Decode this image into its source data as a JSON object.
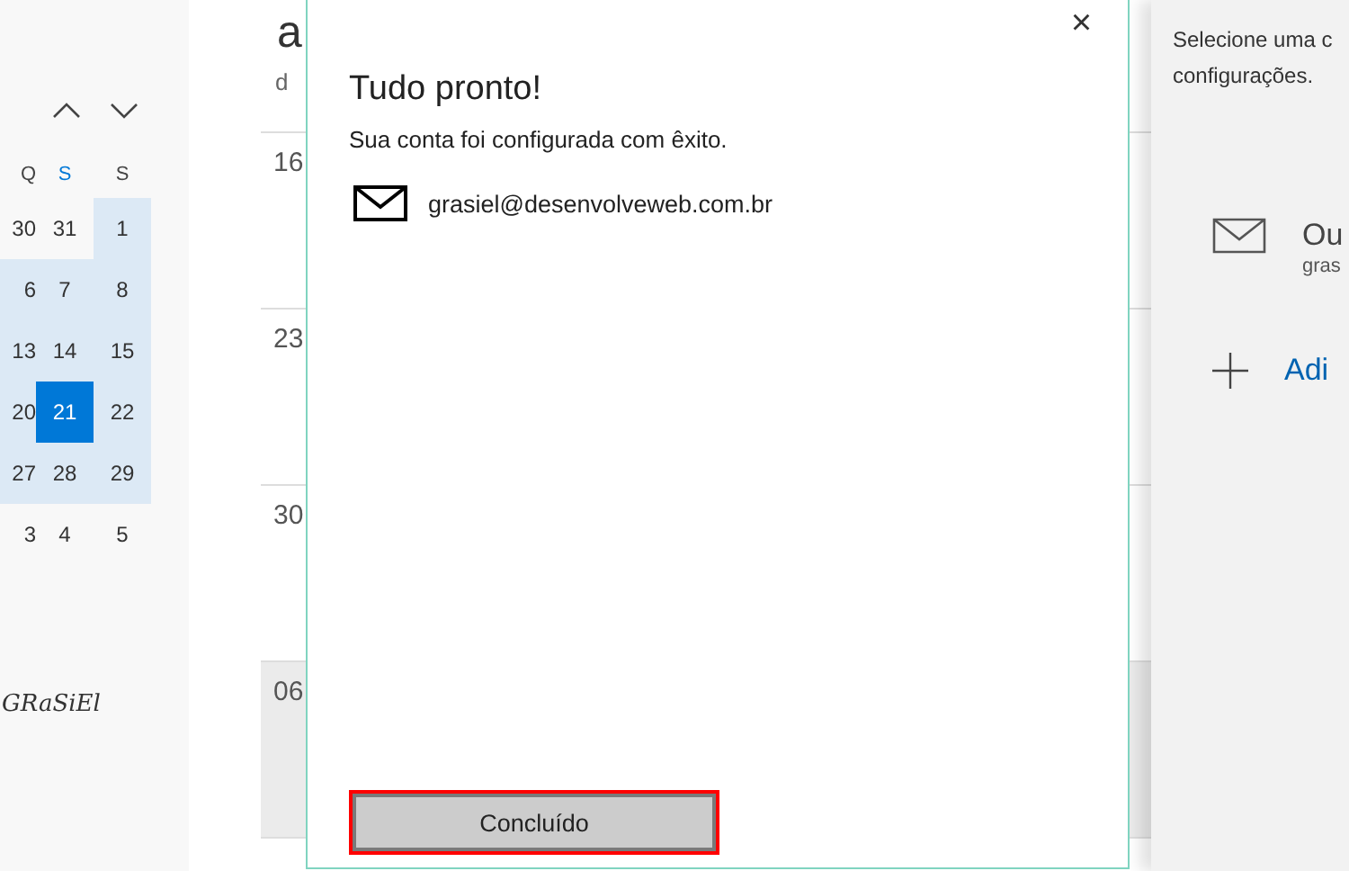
{
  "mini_calendar": {
    "weekdays": [
      {
        "label": "Q",
        "current": false
      },
      {
        "label": "S",
        "current": true
      },
      {
        "label": "S",
        "current": false
      }
    ],
    "weeks": [
      [
        {
          "day": "30",
          "in_range": false,
          "selected": false
        },
        {
          "day": "31",
          "in_range": false,
          "selected": false
        },
        {
          "day": "1",
          "in_range": true,
          "selected": false
        }
      ],
      [
        {
          "day": "6",
          "in_range": true,
          "selected": false
        },
        {
          "day": "7",
          "in_range": true,
          "selected": false
        },
        {
          "day": "8",
          "in_range": true,
          "selected": false
        }
      ],
      [
        {
          "day": "13",
          "in_range": true,
          "selected": false
        },
        {
          "day": "14",
          "in_range": true,
          "selected": false
        },
        {
          "day": "15",
          "in_range": true,
          "selected": false
        }
      ],
      [
        {
          "day": "20",
          "in_range": true,
          "selected": false
        },
        {
          "day": "21",
          "in_range": true,
          "selected": true
        },
        {
          "day": "22",
          "in_range": true,
          "selected": false
        }
      ],
      [
        {
          "day": "27",
          "in_range": true,
          "selected": false
        },
        {
          "day": "28",
          "in_range": true,
          "selected": false
        },
        {
          "day": "29",
          "in_range": true,
          "selected": false
        }
      ],
      [
        {
          "day": "3",
          "in_range": false,
          "selected": false
        },
        {
          "day": "4",
          "in_range": false,
          "selected": false
        },
        {
          "day": "5",
          "in_range": false,
          "selected": false
        }
      ]
    ]
  },
  "signature": "GRaSiEl",
  "calendar": {
    "month": "a",
    "weekday": "d",
    "weeks": [
      {
        "day": "16",
        "shaded": false
      },
      {
        "day": "23",
        "shaded": false
      },
      {
        "day": "30",
        "shaded": false
      },
      {
        "day": "06",
        "shaded": true
      }
    ]
  },
  "dialog": {
    "close": "×",
    "title": "Tudo pronto!",
    "message": "Sua conta foi configurada com êxito.",
    "account": "grasiel@desenvolveweb.com.br",
    "button": "Concluído"
  },
  "accounts_panel": {
    "hint": [
      "Selecione uma c",
      "configurações."
    ],
    "account": {
      "name": "Ou",
      "email": "gras"
    },
    "add": "Adi"
  }
}
